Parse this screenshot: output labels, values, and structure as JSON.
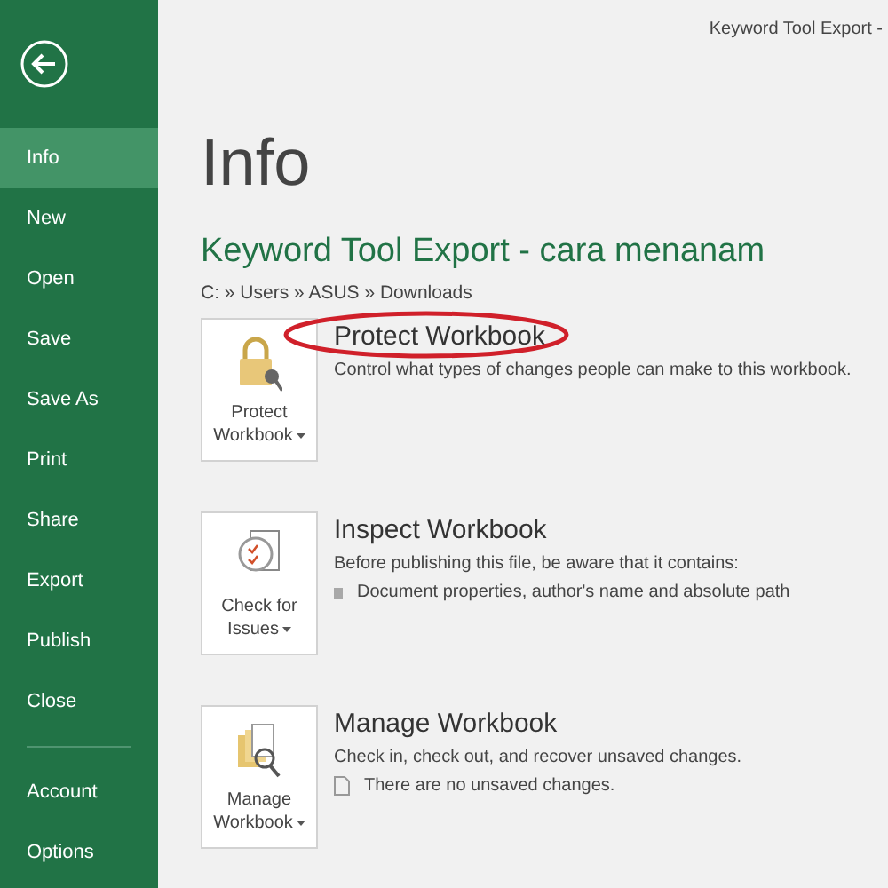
{
  "window": {
    "title": "Keyword Tool Export -"
  },
  "sidebar": {
    "items": [
      {
        "label": "Info",
        "selected": true
      },
      {
        "label": "New",
        "selected": false
      },
      {
        "label": "Open",
        "selected": false
      },
      {
        "label": "Save",
        "selected": false
      },
      {
        "label": "Save As",
        "selected": false
      },
      {
        "label": "Print",
        "selected": false
      },
      {
        "label": "Share",
        "selected": false
      },
      {
        "label": "Export",
        "selected": false
      },
      {
        "label": "Publish",
        "selected": false
      },
      {
        "label": "Close",
        "selected": false
      }
    ],
    "footer_items": [
      {
        "label": "Account",
        "selected": false
      },
      {
        "label": "Options",
        "selected": false
      }
    ]
  },
  "page": {
    "heading": "Info",
    "document_title": "Keyword Tool Export - cara menanam",
    "path": "C: » Users » ASUS » Downloads"
  },
  "sections": [
    {
      "kind": "protect",
      "button_label": "Protect Workbook",
      "title": "Protect Workbook",
      "highlighted": true,
      "description": "Control what types of changes people can make to this workbook."
    },
    {
      "kind": "inspect",
      "button_label": "Check for Issues",
      "title": "Inspect Workbook",
      "highlighted": false,
      "description": "Before publishing this file, be aware that it contains:",
      "details": [
        {
          "kind": "bullet",
          "text": "Document properties, author's name and absolute path"
        }
      ]
    },
    {
      "kind": "manage",
      "button_label": "Manage Workbook",
      "title": "Manage Workbook",
      "highlighted": false,
      "description": "Check in, check out, and recover unsaved changes.",
      "details": [
        {
          "kind": "file",
          "text": "There are no unsaved changes."
        }
      ]
    }
  ]
}
